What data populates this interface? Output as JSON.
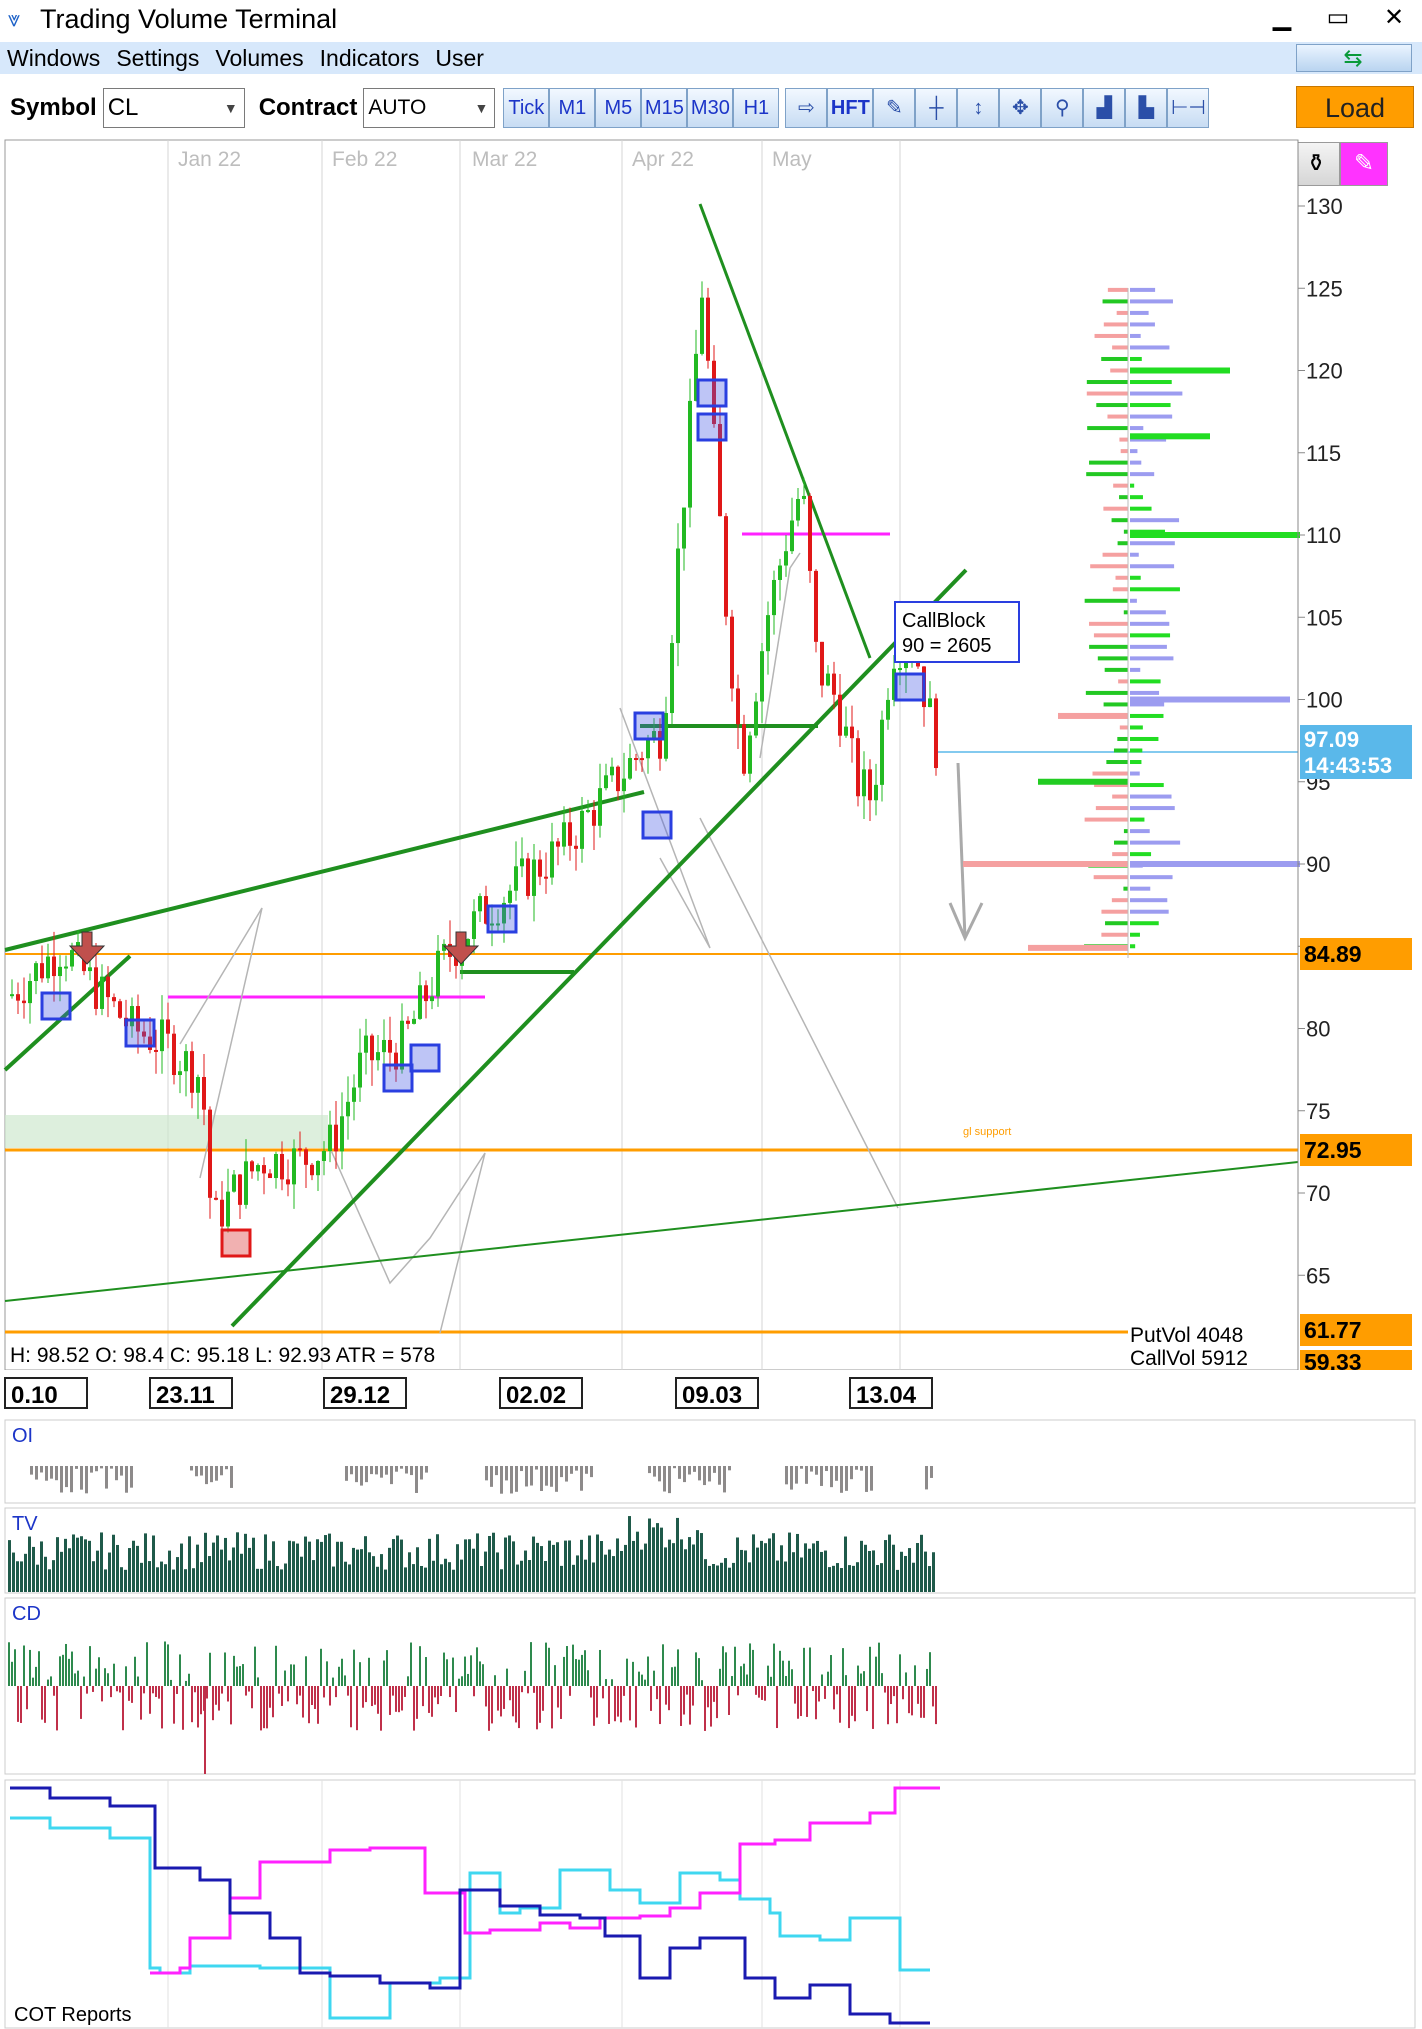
{
  "window": {
    "title": "Trading Volume Terminal",
    "min": "▁",
    "max": "▭",
    "close": "✕"
  },
  "menu": [
    "Windows",
    "Settings",
    "Volumes",
    "Indicators",
    "User"
  ],
  "toolbar": {
    "symbol_label": "Symbol",
    "symbol_value": "CL",
    "contract_label": "Contract",
    "contract_value": "AUTO",
    "timeframes": [
      "Tick",
      "M1",
      "M5",
      "M15",
      "M30",
      "H1"
    ],
    "hft_label": "HFT",
    "load_label": "Load",
    "tool_icons": [
      "star-arrow-icon",
      "pen-icon",
      "crosshair-icon",
      "vertical-resize-icon",
      "move-icon",
      "zoom-icon",
      "volume-bars-icon",
      "delta-bars-icon",
      "range-icon"
    ]
  },
  "drawing_tools": [
    "vertical-line-icon",
    "horizontal-line-icon",
    "trend-line-icon",
    "rectangle-icon",
    "ellipse-icon",
    "text-icon",
    "buy-arrow-icon",
    "sell-arrow-icon",
    "dollar-icon",
    "fibo-icon",
    "brush-icon",
    "pencil-icon"
  ],
  "main_chart": {
    "month_labels": [
      "Jan 22",
      "Feb 22",
      "Mar 22",
      "Apr 22",
      "May"
    ],
    "y_ticks": [
      "130",
      "125",
      "120",
      "115",
      "110",
      "105",
      "100",
      "95",
      "90",
      "85",
      "80",
      "75",
      "70",
      "65"
    ],
    "price_tags": [
      {
        "value": "97.09",
        "sub": "14:43:53",
        "color": "#5ab8ea"
      },
      {
        "value": "84.89",
        "color": "#ff9d00"
      },
      {
        "value": "72.95",
        "color": "#ff9d00"
      },
      {
        "value": "61.77",
        "color": "#ff9d00"
      },
      {
        "value": "59.33",
        "color": "#ff9d00"
      }
    ],
    "callblock": {
      "line1": "CallBlock",
      "line2": "90 = 2605"
    },
    "support_label": "gl support",
    "ohlc": "H: 98.52  O: 98.4  C: 95.18  L: 92.93  ATR = 578",
    "putvol": "PutVol  4048",
    "callvol": "CallVol  5912",
    "date_labels": [
      "0.10",
      "23.11",
      "29.12",
      "02.02",
      "09.03",
      "13.04"
    ]
  },
  "panes": {
    "oi": "OI",
    "tv": "TV",
    "cd": "CD",
    "cot": "COT Reports"
  },
  "colors": {
    "up": "#22b922",
    "down": "#e01818",
    "trend": "#1f8f1f",
    "magenta": "#ff22ff",
    "cyan": "#3fd7f0",
    "navy": "#1a1ab0",
    "orange": "#ff9d00"
  }
}
